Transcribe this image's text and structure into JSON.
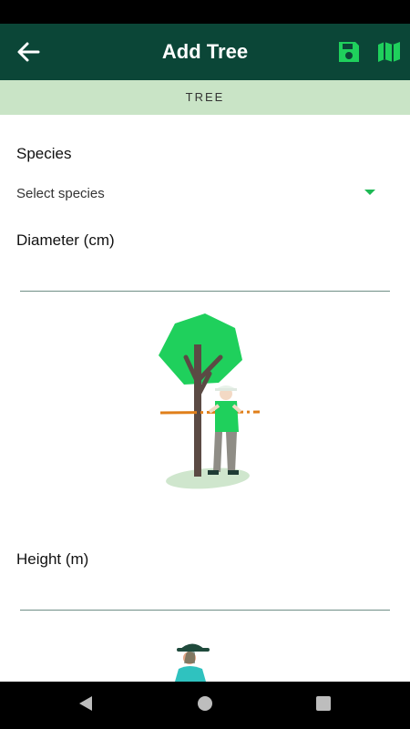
{
  "appbar": {
    "title": "Add Tree",
    "back_icon": "arrow-left-icon",
    "save_icon": "floppy-disk-icon",
    "map_icon": "map-icon"
  },
  "tab": {
    "label": "TREE"
  },
  "form": {
    "species_label": "Species",
    "species_placeholder": "Select species",
    "diameter_label": "Diameter (cm)",
    "height_label": "Height (m)"
  },
  "colors": {
    "appbar_bg": "#0b4637",
    "accent": "#1db954",
    "tab_bg": "#c9e4c6"
  },
  "navbar": {
    "back_icon": "triangle-back-icon",
    "home_icon": "circle-home-icon",
    "recents_icon": "square-recents-icon"
  }
}
